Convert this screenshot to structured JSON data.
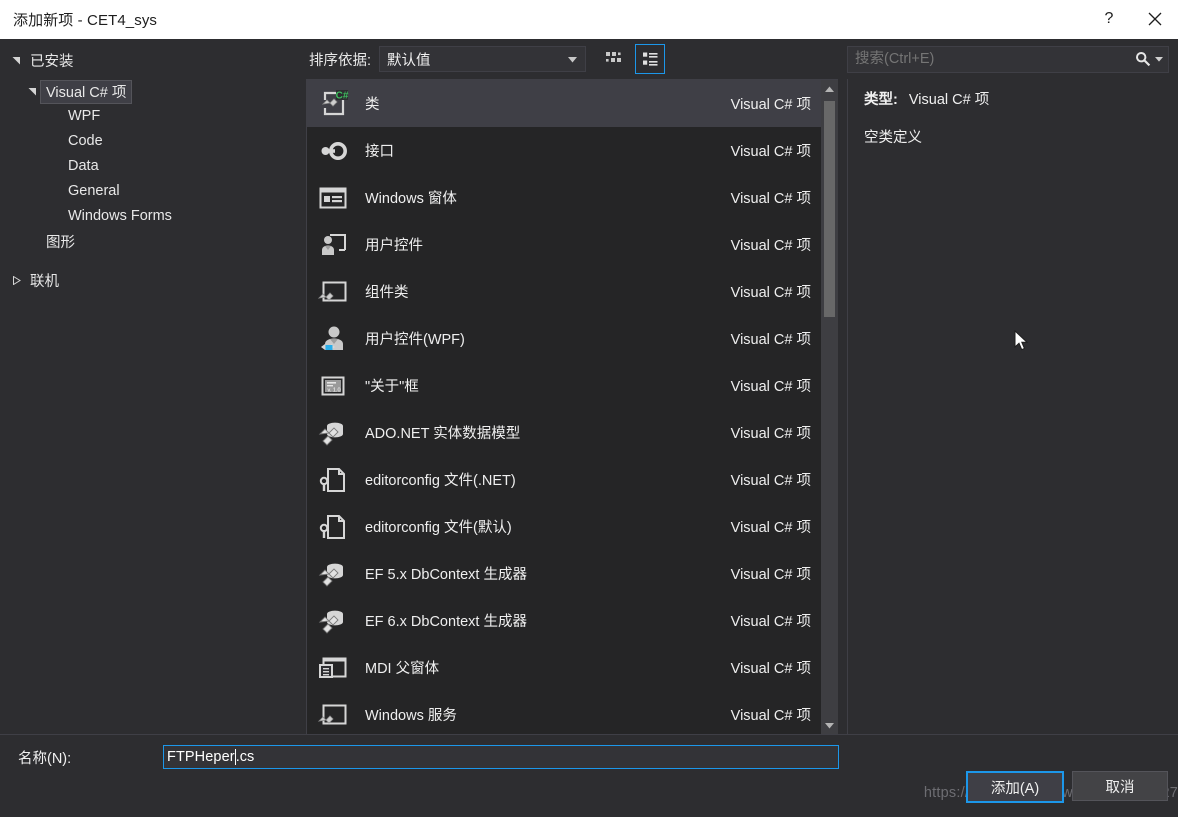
{
  "window": {
    "title": "添加新项 - CET4_sys",
    "help_label": "?",
    "close_label": "✕"
  },
  "sidebar": {
    "items": [
      {
        "label": "已安装",
        "level": 0,
        "arrow": "expanded",
        "selected": false
      },
      {
        "label": "Visual C# 项",
        "level": 1,
        "arrow": "expanded",
        "selected": true
      },
      {
        "label": "WPF",
        "level": 2,
        "arrow": "none",
        "selected": false
      },
      {
        "label": "Code",
        "level": 2,
        "arrow": "none",
        "selected": false
      },
      {
        "label": "Data",
        "level": 2,
        "arrow": "none",
        "selected": false
      },
      {
        "label": "General",
        "level": 2,
        "arrow": "none",
        "selected": false
      },
      {
        "label": "Windows Forms",
        "level": 2,
        "arrow": "none",
        "selected": false
      },
      {
        "label": "图形",
        "level": 1,
        "arrow": "none",
        "selected": false
      },
      {
        "label": "联机",
        "level": 0,
        "arrow": "collapsed",
        "selected": false
      }
    ]
  },
  "toolbar": {
    "sort_label": "排序依据:",
    "sort_value": "默认值",
    "tiles_view_tooltip": "中等图标",
    "list_view_tooltip": "详细信息",
    "active_view": "list"
  },
  "search": {
    "placeholder": "搜索(Ctrl+E)"
  },
  "list": {
    "kind_column": "Visual C# 项",
    "items": [
      {
        "name": "类",
        "kind": "Visual C# 项",
        "icon": "class-icon",
        "selected": true
      },
      {
        "name": "接口",
        "kind": "Visual C# 项",
        "icon": "interface-icon",
        "selected": false
      },
      {
        "name": "Windows 窗体",
        "kind": "Visual C# 项",
        "icon": "windows-form-icon",
        "selected": false
      },
      {
        "name": "用户控件",
        "kind": "Visual C# 项",
        "icon": "user-control-icon",
        "selected": false
      },
      {
        "name": "组件类",
        "kind": "Visual C# 项",
        "icon": "component-class-icon",
        "selected": false
      },
      {
        "name": "用户控件(WPF)",
        "kind": "Visual C# 项",
        "icon": "user-control-wpf-icon",
        "selected": false
      },
      {
        "name": "\"关于\"框",
        "kind": "Visual C# 项",
        "icon": "about-box-icon",
        "selected": false
      },
      {
        "name": "ADO.NET 实体数据模型",
        "kind": "Visual C# 项",
        "icon": "entity-data-model-icon",
        "selected": false
      },
      {
        "name": "editorconfig 文件(.NET)",
        "kind": "Visual C# 项",
        "icon": "editorconfig-icon",
        "selected": false
      },
      {
        "name": "editorconfig 文件(默认)",
        "kind": "Visual C# 项",
        "icon": "editorconfig-icon",
        "selected": false
      },
      {
        "name": "EF 5.x DbContext 生成器",
        "kind": "Visual C# 项",
        "icon": "entity-data-model-icon",
        "selected": false
      },
      {
        "name": "EF 6.x DbContext 生成器",
        "kind": "Visual C# 项",
        "icon": "entity-data-model-icon",
        "selected": false
      },
      {
        "name": "MDI 父窗体",
        "kind": "Visual C# 项",
        "icon": "mdi-parent-form-icon",
        "selected": false
      },
      {
        "name": "Windows 服务",
        "kind": "Visual C# 项",
        "icon": "windows-service-icon",
        "selected": false
      }
    ]
  },
  "details": {
    "type_key": "类型:",
    "type_value": "Visual C# 项",
    "description": "空类定义"
  },
  "footer": {
    "name_label": "名称(N):",
    "name_value_before_caret": "FTPHeper",
    "name_value_after_caret": ".cs",
    "name_value": "FTPHeper.cs",
    "add_label": "添加(A)",
    "cancel_label": "取消",
    "watermark": "https://blog.csdn.net/weixin_44534727"
  },
  "colors": {
    "accent": "#1c97ea",
    "dialog_bg": "#2d2d30",
    "list_bg": "#252526",
    "selection": "#3f3f46",
    "titlebar_bg": "#ffffff",
    "csharp_badge": "#3fbf5f"
  }
}
